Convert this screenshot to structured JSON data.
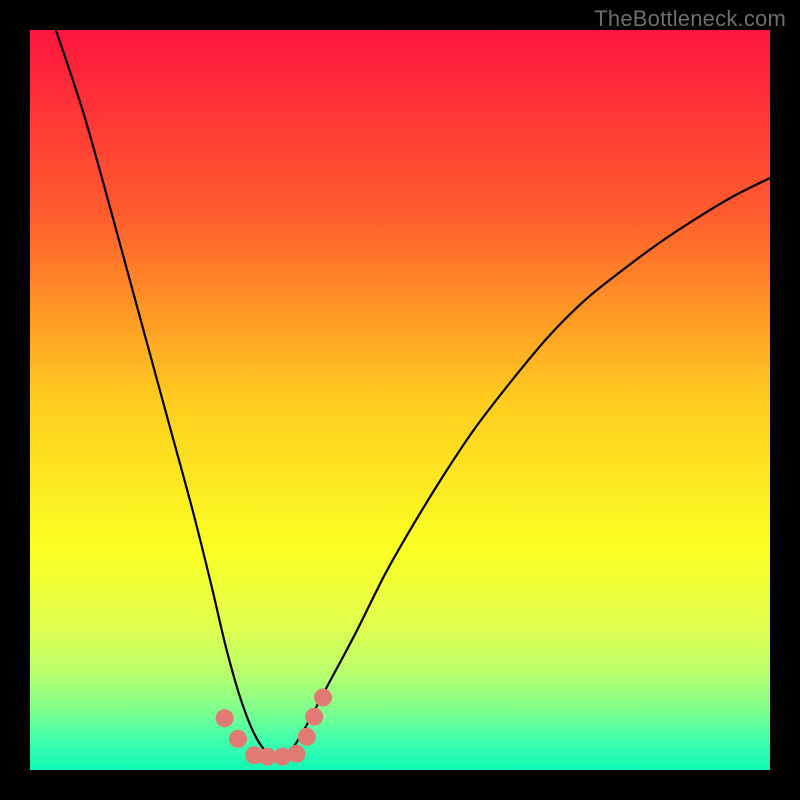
{
  "watermark": "TheBottleneck.com",
  "chart_data": {
    "type": "line",
    "title": "",
    "xlabel": "",
    "ylabel": "",
    "xlim": [
      0,
      1
    ],
    "ylim": [
      0,
      1
    ],
    "background_gradient": {
      "stops": [
        {
          "offset": 0.0,
          "color": "#ff153e"
        },
        {
          "offset": 0.25,
          "color": "#ff5d2d"
        },
        {
          "offset": 0.5,
          "color": "#ffcc1f"
        },
        {
          "offset": 0.7,
          "color": "#fbff23"
        },
        {
          "offset": 0.8,
          "color": "#e3ff4b"
        },
        {
          "offset": 0.87,
          "color": "#b8ff6d"
        },
        {
          "offset": 0.92,
          "color": "#7dff8d"
        },
        {
          "offset": 0.96,
          "color": "#3fffad"
        },
        {
          "offset": 1.0,
          "color": "#11f7b6"
        }
      ]
    },
    "series": [
      {
        "name": "bottleneck-curve",
        "color": "#000000",
        "x": [
          0.035,
          0.07,
          0.1,
          0.13,
          0.16,
          0.19,
          0.22,
          0.245,
          0.265,
          0.285,
          0.305,
          0.325,
          0.345,
          0.365,
          0.4,
          0.44,
          0.48,
          0.52,
          0.56,
          0.6,
          0.65,
          0.7,
          0.75,
          0.8,
          0.85,
          0.9,
          0.95,
          1.0
        ],
        "y": [
          1.0,
          0.895,
          0.79,
          0.68,
          0.57,
          0.46,
          0.35,
          0.25,
          0.165,
          0.095,
          0.045,
          0.02,
          0.02,
          0.045,
          0.11,
          0.185,
          0.265,
          0.335,
          0.4,
          0.46,
          0.525,
          0.585,
          0.635,
          0.675,
          0.712,
          0.745,
          0.775,
          0.8
        ]
      }
    ],
    "markers": {
      "name": "trough-markers",
      "color": "#e07a72",
      "radius_px": 9,
      "points": [
        {
          "x": 0.263,
          "y": 0.07
        },
        {
          "x": 0.281,
          "y": 0.042
        },
        {
          "x": 0.303,
          "y": 0.02
        },
        {
          "x": 0.321,
          "y": 0.018
        },
        {
          "x": 0.341,
          "y": 0.018
        },
        {
          "x": 0.36,
          "y": 0.022
        },
        {
          "x": 0.374,
          "y": 0.045
        },
        {
          "x": 0.384,
          "y": 0.072
        },
        {
          "x": 0.396,
          "y": 0.098
        }
      ]
    }
  }
}
